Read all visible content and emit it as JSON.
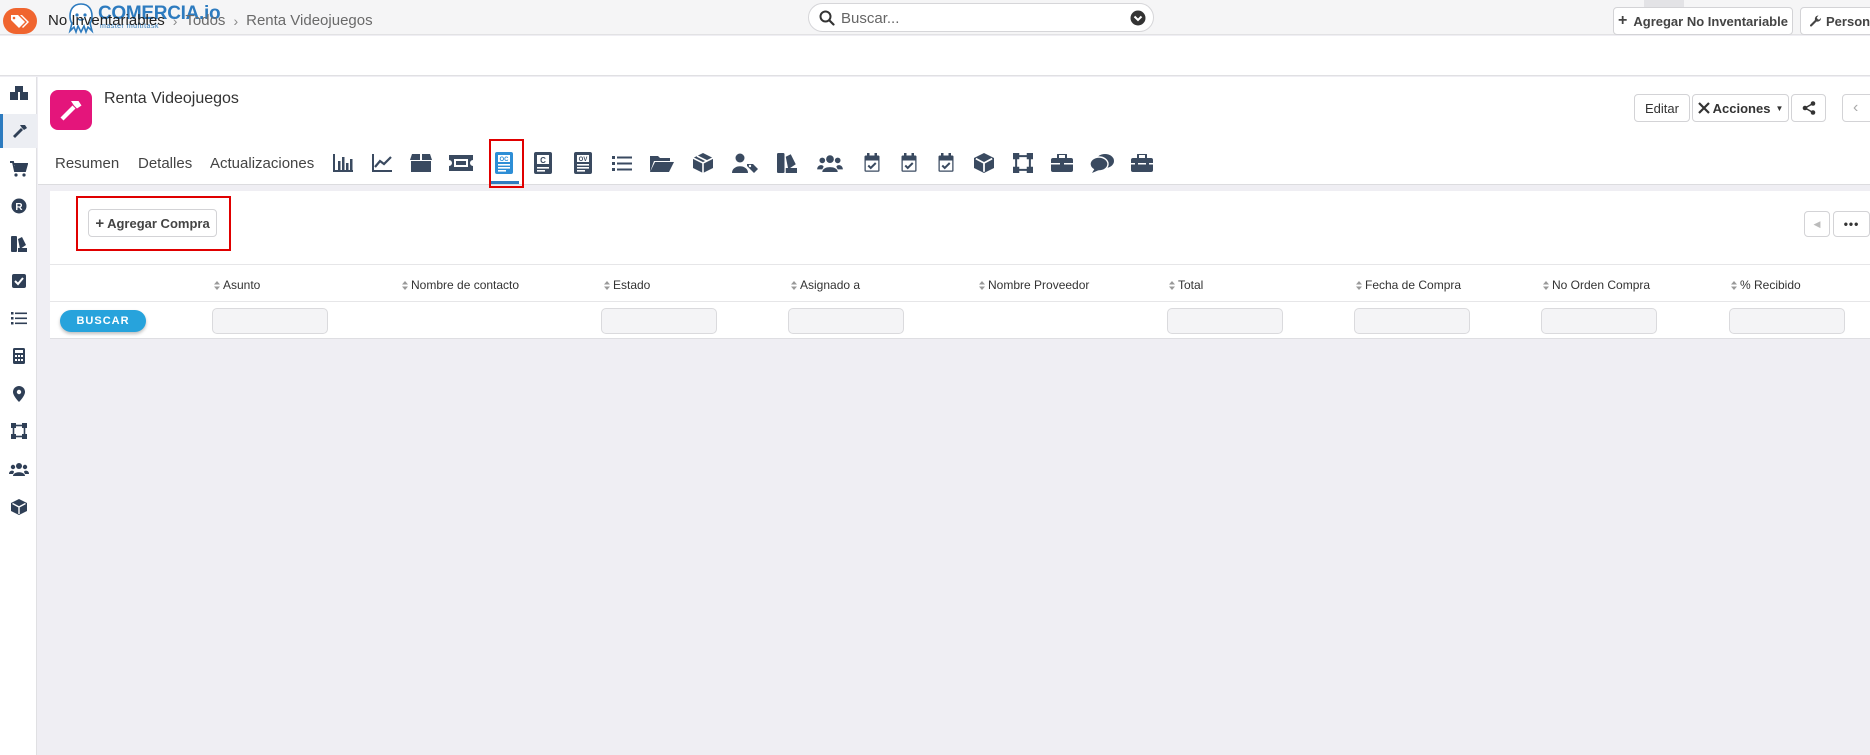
{
  "app": {
    "logo_name": "COMERCIA.io",
    "logo_tagline": "master multitask",
    "search_placeholder": "Buscar..."
  },
  "breadcrumb": {
    "module": "No Inventariables",
    "filter": "Todos",
    "record": "Renta Videojuegos"
  },
  "header_actions": {
    "add_label": "Agregar No Inventariable",
    "customize_label": "Personalizar"
  },
  "record": {
    "title": "Renta Videojuegos",
    "edit_label": "Editar",
    "actions_label": "Acciones"
  },
  "tabs": {
    "summary": "Resumen",
    "details": "Detalles",
    "updates": "Actualizaciones"
  },
  "tab_icons": [
    "chart-bar-icon",
    "chart-line-icon",
    "package-icon",
    "ticket-icon",
    "purchase-order-icon",
    "quote-icon",
    "sales-order-icon",
    "list-icon",
    "folder-icon",
    "box-icon",
    "user-tag-icon",
    "swatch-icon",
    "users-icon",
    "calendar-check-icon",
    "calendar-check-icon",
    "calendar-check-icon",
    "cube-icon",
    "vector-square-icon",
    "briefcase-icon",
    "comments-icon",
    "toolbox-icon"
  ],
  "sidebar_icons": [
    "boxes-icon",
    "hammer-icon",
    "cart-icon",
    "registered-icon",
    "swatch-icon",
    "checkbox-icon",
    "list-icon",
    "calculator-icon",
    "map-marker-icon",
    "vector-square-icon",
    "users-icon",
    "cube-icon"
  ],
  "top_icons": [
    "cash-register-icon",
    "alert-icon",
    "plus-circle-icon",
    "calendar-check-icon",
    "calendar-icon",
    "chart-bar-icon",
    "checkbox-icon"
  ],
  "purchases": {
    "add_label": "Agregar Compra",
    "search_button": "BUSCAR",
    "columns": [
      "Asunto",
      "Nombre de contacto",
      "Estado",
      "Asignado a",
      "Nombre Proveedor",
      "Total",
      "Fecha de Compra",
      "No Orden Compra",
      "% Recibido"
    ]
  },
  "colors": {
    "accent": "#2d7bbf",
    "record_icon": "#e4157b",
    "module_badge": "#f0652f",
    "search_button": "#27a3dc",
    "highlight": "#e00000"
  }
}
